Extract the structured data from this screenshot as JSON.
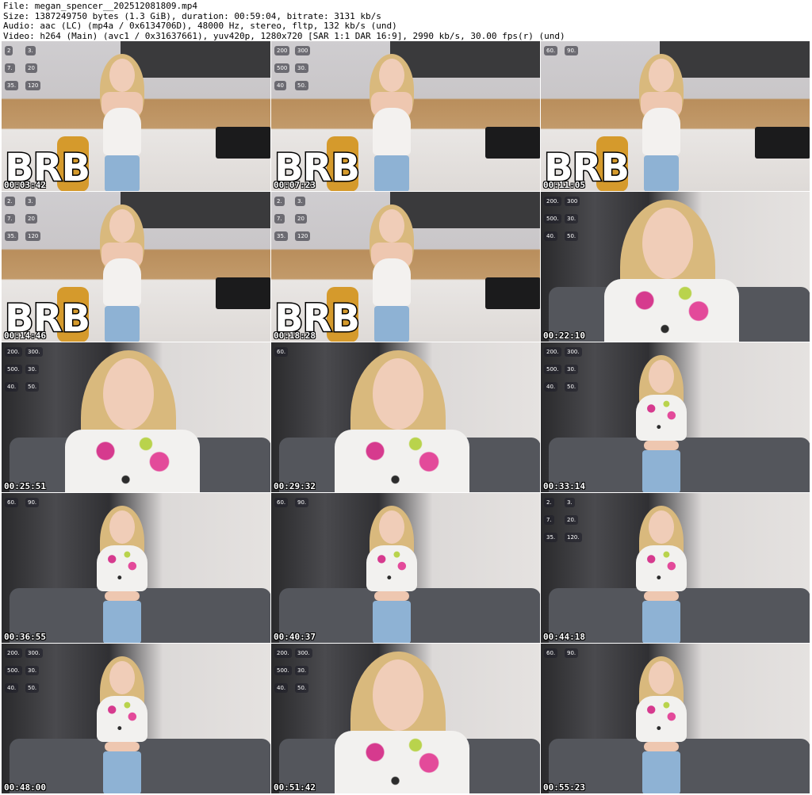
{
  "header": {
    "file": "File: megan_spencer__202512081809.mp4",
    "size": "Size: 1387249750 bytes (1.3 GiB), duration: 00:59:04, bitrate: 3131 kb/s",
    "audio": "Audio: aac (LC) (mp4a / 0x6134706D), 48000 Hz, stereo, fltp, 132 kb/s (und)",
    "video": "Video: h264 (Main) (avc1 / 0x31637661), yuv420p, 1280x720 [SAR 1:1 DAR 16:9], 2990 kb/s, 30.00 fps(r) (und)"
  },
  "brb_text": "BRB",
  "thumbnails": [
    {
      "ts": "00:03:42",
      "scene": "kitchen",
      "brb": true,
      "panel": [
        "2",
        "3.",
        "7.",
        "20",
        "35.",
        "120"
      ]
    },
    {
      "ts": "00:07:23",
      "scene": "kitchen",
      "brb": true,
      "panel": [
        "200",
        "300",
        "500",
        "30.",
        "40",
        "50."
      ]
    },
    {
      "ts": "00:11:05",
      "scene": "kitchen",
      "brb": true,
      "panel": [
        "60.",
        "90."
      ]
    },
    {
      "ts": "00:14:46",
      "scene": "kitchen",
      "brb": true,
      "panel": [
        "2.",
        "3.",
        "7.",
        "20",
        "35.",
        "120"
      ]
    },
    {
      "ts": "00:18:28",
      "scene": "kitchen",
      "brb": true,
      "panel": [
        "2.",
        "3.",
        "7.",
        "20",
        "35.",
        "120"
      ]
    },
    {
      "ts": "00:22:10",
      "scene": "sofa",
      "brb": false,
      "panel": [
        "200.",
        "300",
        "500.",
        "30.",
        "40.",
        "50."
      ]
    },
    {
      "ts": "00:25:51",
      "scene": "sofa",
      "brb": false,
      "panel": [
        "200.",
        "300.",
        "500.",
        "30.",
        "40.",
        "50."
      ]
    },
    {
      "ts": "00:29:32",
      "scene": "sofa",
      "brb": false,
      "panel": [
        "60."
      ]
    },
    {
      "ts": "00:33:14",
      "scene": "sofa",
      "brb": false,
      "panel": [
        "200.",
        "300.",
        "500.",
        "30.",
        "40.",
        "50."
      ]
    },
    {
      "ts": "00:36:55",
      "scene": "sofa",
      "brb": false,
      "panel": [
        "60.",
        "90."
      ]
    },
    {
      "ts": "00:40:37",
      "scene": "sofa",
      "brb": false,
      "panel": [
        "60.",
        "90."
      ]
    },
    {
      "ts": "00:44:18",
      "scene": "sofa",
      "brb": false,
      "panel": [
        "2.",
        "3.",
        "7.",
        "20.",
        "35.",
        "120."
      ]
    },
    {
      "ts": "00:48:00",
      "scene": "sofa",
      "brb": false,
      "panel": [
        "200.",
        "300.",
        "500.",
        "30.",
        "40.",
        "50."
      ]
    },
    {
      "ts": "00:51:42",
      "scene": "sofa",
      "brb": false,
      "panel": [
        "200.",
        "300.",
        "500.",
        "30.",
        "40.",
        "50."
      ]
    },
    {
      "ts": "00:55:23",
      "scene": "sofa",
      "brb": false,
      "panel": [
        "60.",
        "90."
      ]
    }
  ]
}
